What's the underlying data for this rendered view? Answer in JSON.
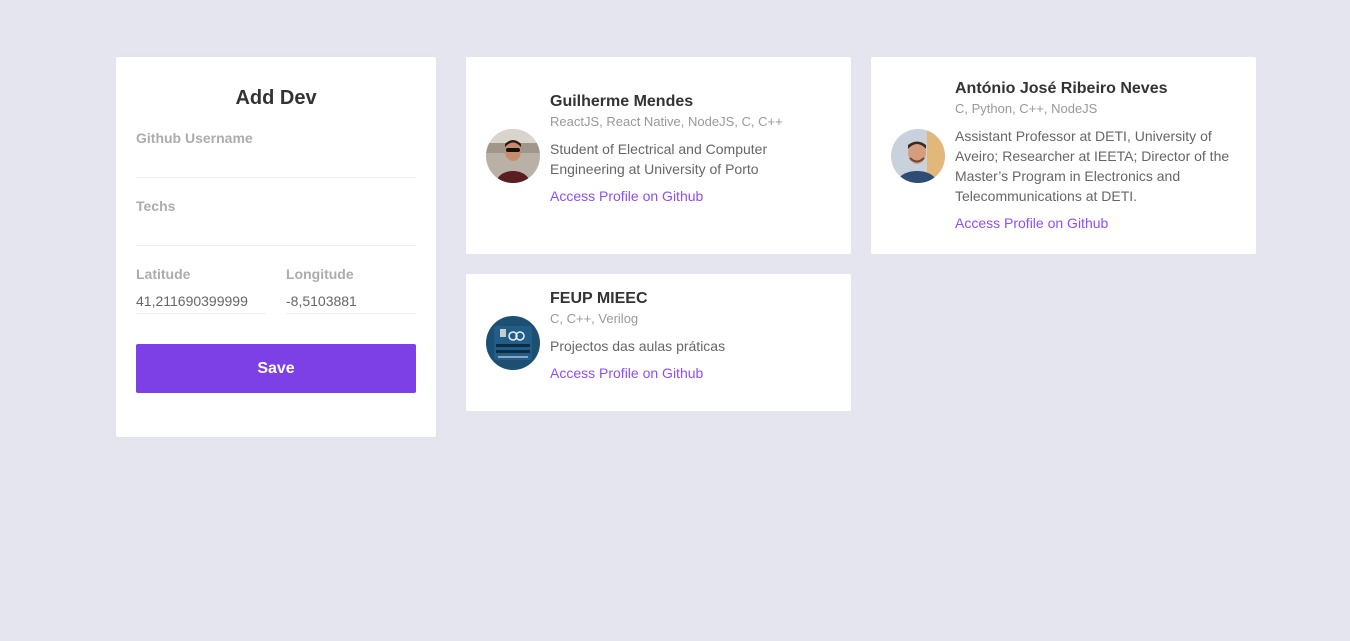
{
  "form": {
    "title": "Add Dev",
    "github_username_label": "Github Username",
    "github_username_value": "",
    "techs_label": "Techs",
    "techs_value": "",
    "latitude_label": "Latitude",
    "latitude_value": "41,211690399999",
    "longitude_label": "Longitude",
    "longitude_value": "-8,5103881",
    "save_label": "Save"
  },
  "colors": {
    "background": "#e5e5ef",
    "accent": "#7d40e7",
    "link": "#8e4dff"
  },
  "devs": [
    {
      "name": "Guilherme Mendes",
      "techs": "ReactJS, React Native, NodeJS, C, C++",
      "bio": "Student of Electrical and Computer Engineering at University of Porto",
      "link_label": "Access Profile on Github",
      "avatar_icon": "user-avatar"
    },
    {
      "name": "António José Ribeiro Neves",
      "techs": "C, Python, C++, NodeJS",
      "bio": "Assistant Professor at DETI, University of Aveiro; Researcher at IEETA; Director of the Master’s Program in Electronics and Telecommunications at DETI.",
      "link_label": "Access Profile on Github",
      "avatar_icon": "user-avatar"
    },
    {
      "name": "FEUP MIEEC",
      "techs": "C, C++, Verilog",
      "bio": "Projectos das aulas práticas",
      "link_label": "Access Profile on Github",
      "avatar_icon": "circuit-board-avatar"
    }
  ]
}
